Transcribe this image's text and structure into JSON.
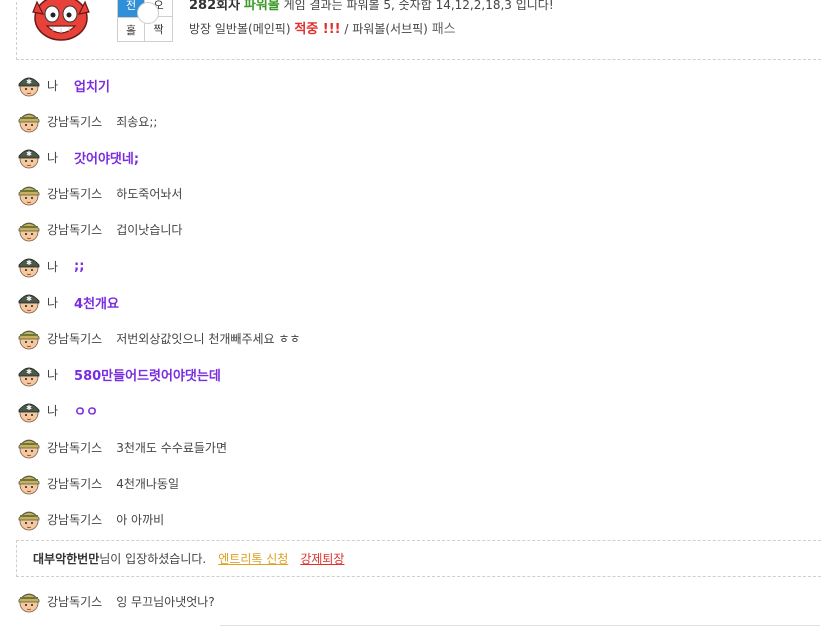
{
  "result": {
    "grid": [
      "전",
      "오",
      "홀",
      "짝"
    ],
    "round": "282회자",
    "game": "파워볼",
    "line1_rest": "게임 결과는 파워볼 5, 숫자합 14,12,2,18,3 입니다!",
    "pick_main": "방장 일반볼(메인픽)",
    "hit": "적중 !!!",
    "pick_sub": "/ 파워볼(서브픽)",
    "pass": "패스"
  },
  "messages": [
    {
      "nick": "나",
      "text": "업치기",
      "mine": true
    },
    {
      "nick": "강남독기스",
      "text": "죄송요;;",
      "mine": false
    },
    {
      "nick": "나",
      "text": "갓어야댓네;",
      "mine": true
    },
    {
      "nick": "강남독기스",
      "text": "하도죽어놔서",
      "mine": false
    },
    {
      "nick": "강남독기스",
      "text": "겁이낫습니다",
      "mine": false
    },
    {
      "nick": "나",
      "text": ";;",
      "mine": true
    },
    {
      "nick": "나",
      "text": "4천개요",
      "mine": true
    },
    {
      "nick": "강남독기스",
      "text": "저번외상값잇으니 천개빼주세요 ㅎㅎ",
      "mine": false
    },
    {
      "nick": "나",
      "text": "580만들어드렷어야댓는데",
      "mine": true
    },
    {
      "nick": "나",
      "text": "ㅇㅇ",
      "mine": true
    },
    {
      "nick": "강남독기스",
      "text": "3천개도 수수료들가면",
      "mine": false
    },
    {
      "nick": "강남독기스",
      "text": "4천개나동일",
      "mine": false
    },
    {
      "nick": "강남독기스",
      "text": "아 아까비",
      "mine": false
    }
  ],
  "notice": {
    "who": "대부악한번만",
    "text": "님이 입장하셨습니다.",
    "link1": "엔트리톡 신청",
    "link2": "강제퇴장"
  },
  "last_message": {
    "nick": "강남독기스",
    "text": "잉 무끄님아냇엇나?"
  },
  "colors": {
    "mine_text": "#7a2ce0",
    "game": "#3a9a28",
    "hit": "#e0302c",
    "link_yellow": "#e0a020",
    "grid_blue": "#2f8fd8"
  }
}
